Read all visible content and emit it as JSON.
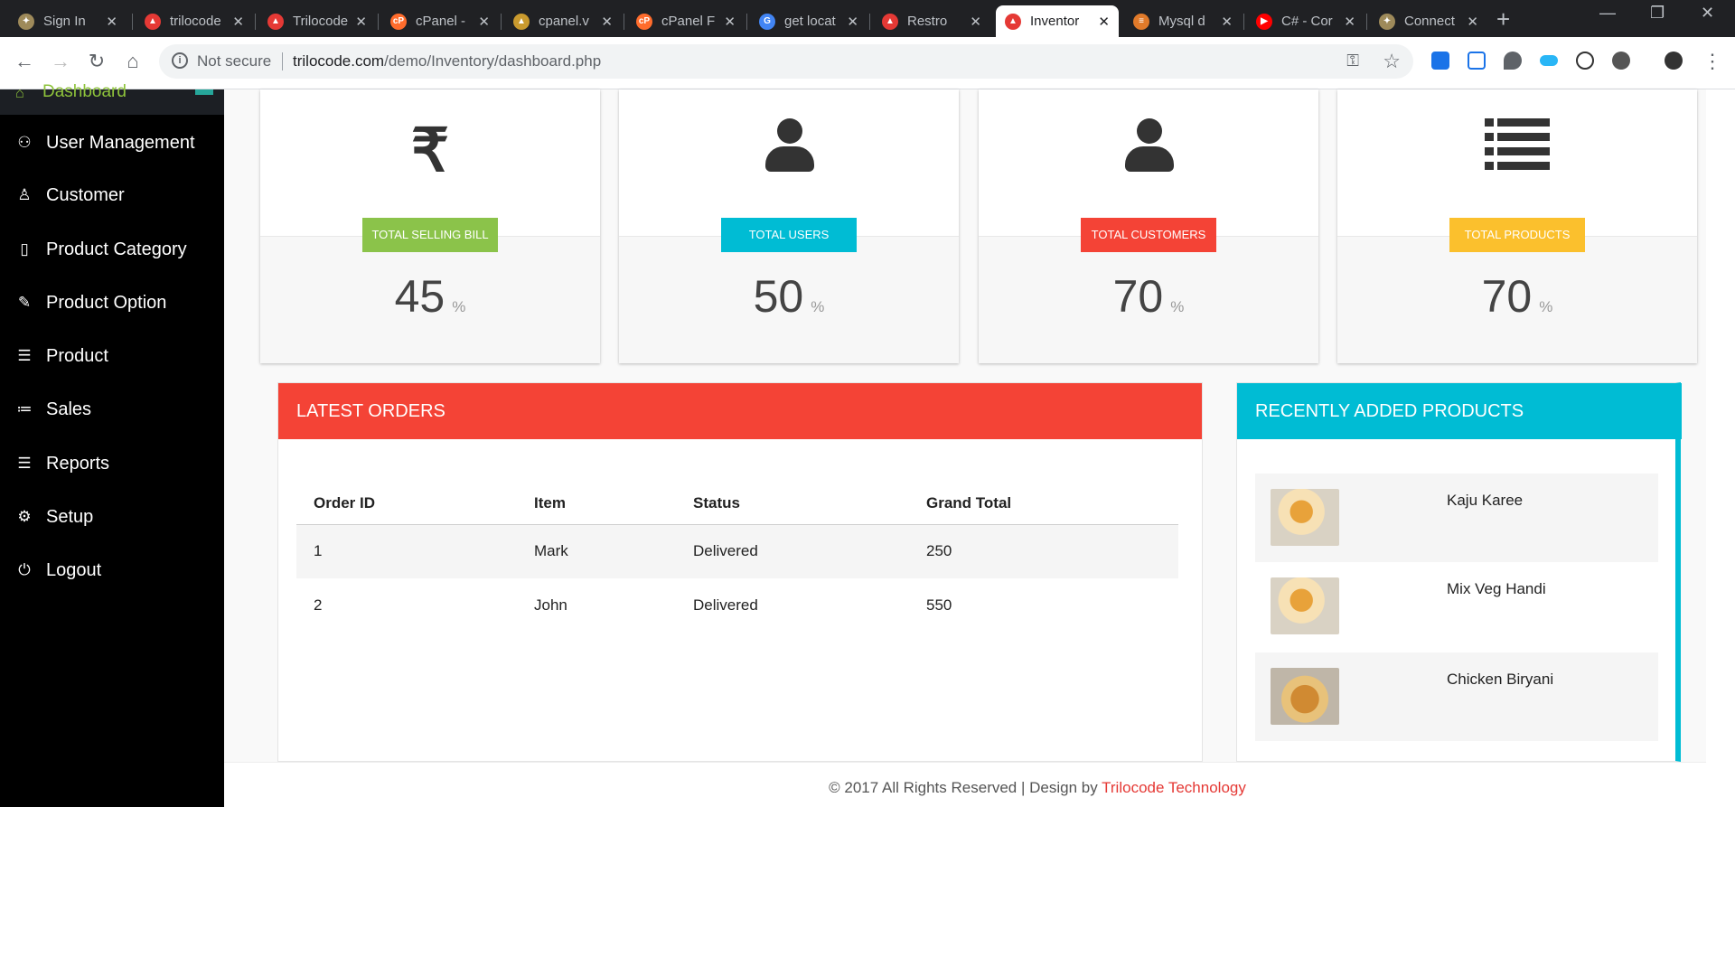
{
  "browser": {
    "tabs": [
      {
        "title": "Sign In",
        "fav_color": "#9e8a5a",
        "fav_glyph": "✦"
      },
      {
        "title": "trilocode",
        "fav_color": "#e53935",
        "fav_glyph": "▲"
      },
      {
        "title": "Trilocode",
        "fav_color": "#e53935",
        "fav_glyph": "▲"
      },
      {
        "title": "cPanel -",
        "fav_color": "#ff6c2c",
        "fav_glyph": "cP"
      },
      {
        "title": "cpanel.v",
        "fav_color": "#c99a2e",
        "fav_glyph": "▲"
      },
      {
        "title": "cPanel F",
        "fav_color": "#ff6c2c",
        "fav_glyph": "cP"
      },
      {
        "title": "get locat",
        "fav_color": "#4285f4",
        "fav_glyph": "G"
      },
      {
        "title": "Restro",
        "fav_color": "#e53935",
        "fav_glyph": "▲"
      },
      {
        "title": "Inventor",
        "fav_color": "#e53935",
        "fav_glyph": "▲"
      },
      {
        "title": "Mysql d",
        "fav_color": "#e07a2a",
        "fav_glyph": "≡"
      },
      {
        "title": "C# - Cor",
        "fav_color": "#ff0000",
        "fav_glyph": "▶"
      },
      {
        "title": "Connect",
        "fav_color": "#9e8a5a",
        "fav_glyph": "✦"
      }
    ],
    "active_tab_index": 8,
    "security_label": "Not secure",
    "url_host": "trilocode.com",
    "url_path": "/demo/Inventory/dashboard.php"
  },
  "sidebar": {
    "active_item": "Dashboard",
    "items": [
      "User Management",
      "Customer",
      "Product Category",
      "Product Option",
      "Product",
      "Sales",
      "Reports",
      "Setup",
      "Logout"
    ],
    "icons": [
      "users-icon",
      "user-icon",
      "book-icon",
      "pencil-icon",
      "database-icon",
      "list-icon",
      "list-icon",
      "gear-icon",
      "power-icon"
    ]
  },
  "stats": [
    {
      "label": "TOTAL SELLING BILL",
      "value": "45",
      "unit": "%",
      "color": "#8bc34a",
      "icon": "rupee-icon"
    },
    {
      "label": "TOTAL USERS",
      "value": "50",
      "unit": "%",
      "color": "#00bcd4",
      "icon": "user-icon"
    },
    {
      "label": "TOTAL CUSTOMERS",
      "value": "70",
      "unit": "%",
      "color": "#f44336",
      "icon": "user-icon"
    },
    {
      "label": "TOTAL PRODUCTS",
      "value": "70",
      "unit": "%",
      "color": "#fbc02d",
      "icon": "list-icon"
    }
  ],
  "orders": {
    "title": "LATEST ORDERS",
    "color": "#f44336",
    "columns": [
      "Order ID",
      "Item",
      "Status",
      "Grand Total"
    ],
    "rows": [
      [
        "1",
        "Mark",
        "Delivered",
        "250"
      ],
      [
        "2",
        "John",
        "Delivered",
        "550"
      ]
    ]
  },
  "products": {
    "title": "RECENTLY ADDED PRODUCTS",
    "color": "#00bcd4",
    "items": [
      "Kaju Karee",
      "Mix Veg Handi",
      "Chicken Biryani"
    ]
  },
  "footer": {
    "text": "© 2017 All Rights Reserved | Design by ",
    "link": "Trilocode Technology"
  }
}
